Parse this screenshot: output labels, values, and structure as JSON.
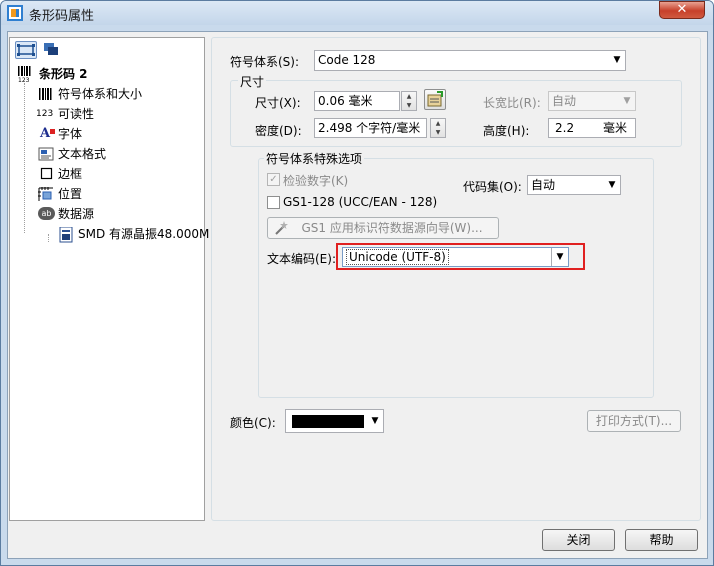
{
  "window": {
    "title": "条形码属性",
    "close_symbol": "✕"
  },
  "tree": {
    "root": {
      "label": "条形码 2",
      "icon": "barcode-icon",
      "icon_text": "123"
    },
    "items": [
      {
        "label": "符号体系和大小",
        "icon": "barcode-bars-icon"
      },
      {
        "label": "可读性",
        "icon": "readability-123-icon",
        "icon_text": "123"
      },
      {
        "label": "字体",
        "icon": "font-icon",
        "icon_text": "A"
      },
      {
        "label": "文本格式",
        "icon": "text-format-icon"
      },
      {
        "label": "边框",
        "icon": "border-icon"
      },
      {
        "label": "位置",
        "icon": "position-icon"
      },
      {
        "label": "数据源",
        "icon": "data-source-icon",
        "icon_text": "ab"
      }
    ],
    "subitem": {
      "label": "SMD 有源晶振48.000M",
      "icon": "data-item-icon"
    }
  },
  "symbology": {
    "label": "符号体系(S):",
    "value": "Code 128"
  },
  "size_group": {
    "title": "尺寸",
    "size_label": "尺寸(X):",
    "size_value": "0.06 毫米",
    "aspect_label": "长宽比(R):",
    "aspect_value": "自动",
    "density_label": "密度(D):",
    "density_value": "2.498  个字符/毫米",
    "height_label": "高度(H):",
    "height_value": "2.2",
    "height_unit": "毫米"
  },
  "special_group": {
    "title": "符号体系特殊选项",
    "check_digit_label": "检验数字(K)",
    "check_digit_checked": true,
    "gs1_label": "GS1-128 (UCC/EAN - 128)",
    "gs1_checked": false,
    "gs1_wizard_label": "GS1 应用标识符数据源向导(W)...",
    "code_set_label": "代码集(O):",
    "code_set_value": "自动",
    "text_encoding_label": "文本编码(E):",
    "text_encoding_value": "Unicode (UTF-8)"
  },
  "color": {
    "label": "颜色(C):",
    "swatch": "#000000"
  },
  "print_method_label": "打印方式(T)...",
  "buttons": {
    "close": "关闭",
    "help": "帮助"
  },
  "highlight_color": "#e02020"
}
